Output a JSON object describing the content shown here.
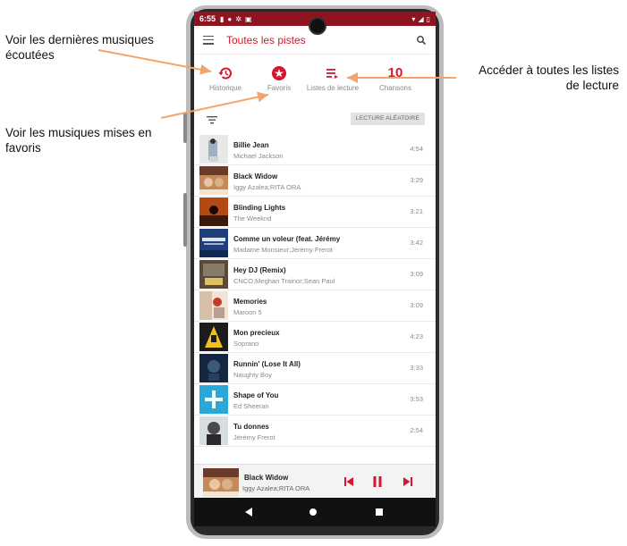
{
  "annotations": {
    "recent": "Voir les dernières musiques\nécoutées",
    "favorites": "Voir les musiques mises en\nfavoris",
    "playlists": "Accéder à toutes les listes\nde lecture"
  },
  "status_bar": {
    "time": "6:55"
  },
  "app_bar": {
    "title": "Toutes les pistes",
    "menu_icon": "hamburger-menu-icon",
    "search_icon": "search-icon"
  },
  "quick_actions": {
    "history_label": "Historique",
    "favorites_label": "Favoris",
    "playlists_label": "Listes de lecture",
    "songs_count": "10",
    "songs_label": "Chansons"
  },
  "controls": {
    "shuffle_label": "LECTURE ALÉATOIRE"
  },
  "tracks": [
    {
      "title": "Billie Jean",
      "artist": "Michael Jackson",
      "duration": "4:54"
    },
    {
      "title": "Black Widow",
      "artist": "Iggy Azalea;RITA ORA",
      "duration": "3:29"
    },
    {
      "title": "Blinding Lights",
      "artist": "The Weeknd",
      "duration": "3:21"
    },
    {
      "title": "Comme un voleur (feat. Jérémy",
      "artist": "Madame Monsieur;Jérémy Frerot",
      "duration": "3:42"
    },
    {
      "title": "Hey DJ (Remix)",
      "artist": "CNCO;Meghan Trainor;Sean Paul",
      "duration": "3:09"
    },
    {
      "title": "Memories",
      "artist": "Maroon 5",
      "duration": "3:09"
    },
    {
      "title": "Mon precieux",
      "artist": "Soprano",
      "duration": "4:23"
    },
    {
      "title": "Runnin' (Lose It All)",
      "artist": "Naughty Boy",
      "duration": "3:33"
    },
    {
      "title": "Shape of You",
      "artist": "Ed Sheeran",
      "duration": "3:53"
    },
    {
      "title": "Tu donnes",
      "artist": "Jérémy Frerot",
      "duration": "2:54"
    }
  ],
  "mini_player": {
    "title": "Black Widow",
    "artist": "Iggy Azalea;RITA ORA"
  },
  "colors": {
    "accent": "#d6162f",
    "status_bar": "#8e1420",
    "annotation_arrow": "#f2a56b"
  }
}
